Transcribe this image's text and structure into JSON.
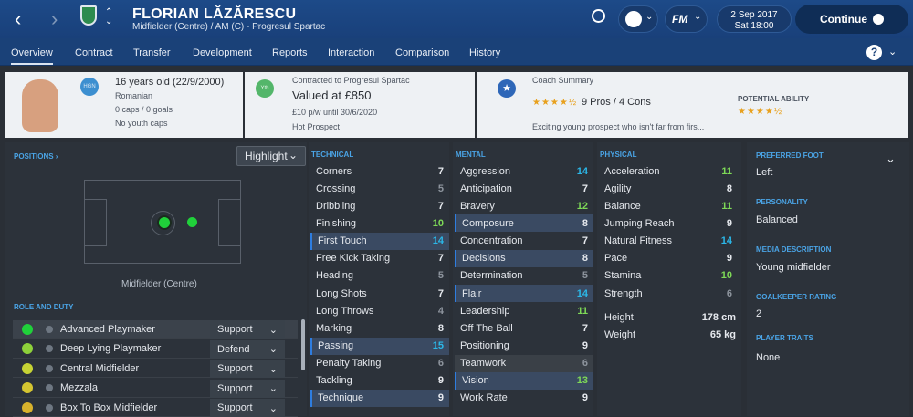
{
  "header": {
    "name": "FLORIAN LĂZĂRESCU",
    "subtitle": "Midfielder (Centre) / AM (C) - Progresul Spartac",
    "date": "2 Sep 2017",
    "time": "Sat 18:00",
    "continue": "Continue"
  },
  "tabs": [
    "Overview",
    "Contract",
    "Transfer",
    "Development",
    "Reports",
    "Interaction",
    "Comparison",
    "History"
  ],
  "bio": {
    "age": "16 years old (22/9/2000)",
    "nation": "Romanian",
    "caps": "0 caps / 0 goals",
    "youth": "No youth caps",
    "nation_code": "HGN"
  },
  "contract": {
    "club": "Contracted to Progresul Spartac",
    "valued": "Valued at £850",
    "wage": "£10 p/w until 30/6/2020",
    "status": "Hot Prospect",
    "badge": "Yth"
  },
  "coach": {
    "title": "Coach Summary",
    "pros": "9 Pros / 4 Cons",
    "summary": "Exciting young prospect who isn't far from firs...",
    "potential_label": "POTENTIAL ABILITY",
    "stars": 4.5,
    "potential_stars": 4.5
  },
  "positions": {
    "label": "POSITIONS ›",
    "highlight": "Highlight",
    "position": "Midfielder (Centre)"
  },
  "role_duty": {
    "label": "ROLE AND DUTY",
    "roles": [
      {
        "name": "Advanced Playmaker",
        "duty": "Support"
      },
      {
        "name": "Deep Lying Playmaker",
        "duty": "Defend"
      },
      {
        "name": "Central Midfielder",
        "duty": "Support"
      },
      {
        "name": "Mezzala",
        "duty": "Support"
      },
      {
        "name": "Box To Box Midfielder",
        "duty": "Support"
      }
    ]
  },
  "technical": {
    "label": "TECHNICAL",
    "attrs": [
      [
        "Corners",
        "7"
      ],
      [
        "Crossing",
        "5"
      ],
      [
        "Dribbling",
        "7"
      ],
      [
        "Finishing",
        "10"
      ],
      [
        "First Touch",
        "14"
      ],
      [
        "Free Kick Taking",
        "7"
      ],
      [
        "Heading",
        "5"
      ],
      [
        "Long Shots",
        "7"
      ],
      [
        "Long Throws",
        "4"
      ],
      [
        "Marking",
        "8"
      ],
      [
        "Passing",
        "15"
      ],
      [
        "Penalty Taking",
        "6"
      ],
      [
        "Tackling",
        "9"
      ],
      [
        "Technique",
        "9"
      ]
    ]
  },
  "mental": {
    "label": "MENTAL",
    "attrs": [
      [
        "Aggression",
        "14"
      ],
      [
        "Anticipation",
        "7"
      ],
      [
        "Bravery",
        "12"
      ],
      [
        "Composure",
        "8"
      ],
      [
        "Concentration",
        "7"
      ],
      [
        "Decisions",
        "8"
      ],
      [
        "Determination",
        "5"
      ],
      [
        "Flair",
        "14"
      ],
      [
        "Leadership",
        "11"
      ],
      [
        "Off The Ball",
        "7"
      ],
      [
        "Positioning",
        "9"
      ],
      [
        "Teamwork",
        "6"
      ],
      [
        "Vision",
        "13"
      ],
      [
        "Work Rate",
        "9"
      ]
    ]
  },
  "physical": {
    "label": "PHYSICAL",
    "attrs": [
      [
        "Acceleration",
        "11"
      ],
      [
        "Agility",
        "8"
      ],
      [
        "Balance",
        "11"
      ],
      [
        "Jumping Reach",
        "9"
      ],
      [
        "Natural Fitness",
        "14"
      ],
      [
        "Pace",
        "9"
      ],
      [
        "Stamina",
        "10"
      ],
      [
        "Strength",
        "6"
      ]
    ],
    "height_label": "Height",
    "height": "178 cm",
    "weight_label": "Weight",
    "weight": "65 kg"
  },
  "side": {
    "foot_label": "PREFERRED FOOT",
    "foot": "Left",
    "personality_label": "PERSONALITY",
    "personality": "Balanced",
    "media_label": "MEDIA DESCRIPTION",
    "media": "Young midfielder",
    "gk_label": "GOALKEEPER RATING",
    "gk": "2",
    "traits_label": "PLAYER TRAITS",
    "traits": "None"
  },
  "colors": {
    "green": "#7ed957",
    "cyan": "#2bb7e8",
    "yellow": "#f0c419",
    "accent": "#1d4a88"
  }
}
